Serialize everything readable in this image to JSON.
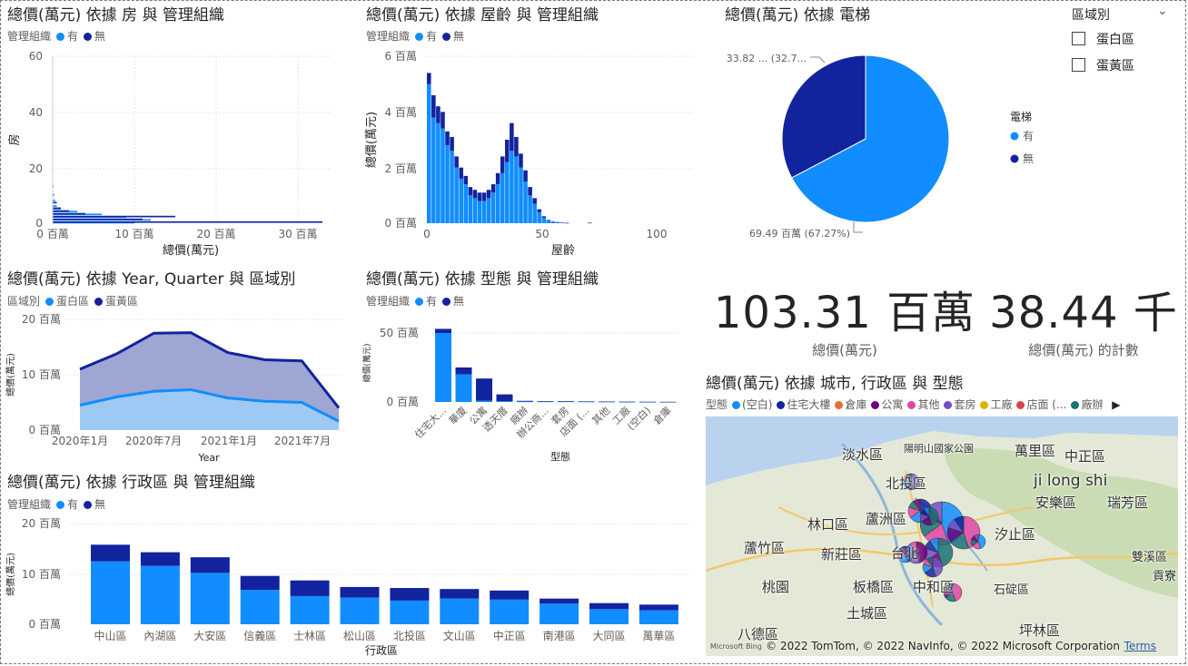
{
  "colors": {
    "light": "#118DFF",
    "dark": "#12239E",
    "purple": "#744EC2"
  },
  "charts": {
    "rooms": {
      "title": "總價(萬元) 依據 房 與 管理組織",
      "legend_title": "管理組織",
      "legend": [
        {
          "name": "有",
          "color": "#118DFF"
        },
        {
          "name": "無",
          "color": "#12239E"
        }
      ],
      "xlabel": "總價(萬元)",
      "ylabel": "房",
      "xticks": [
        "0 百萬",
        "10 百萬",
        "20 百萬",
        "30 百萬"
      ],
      "yticks": [
        "60",
        "40",
        "20",
        "0"
      ]
    },
    "age": {
      "title": "總價(萬元) 依據 屋齡 與 管理組織",
      "legend_title": "管理組織",
      "legend": [
        {
          "name": "有",
          "color": "#118DFF"
        },
        {
          "name": "無",
          "color": "#12239E"
        }
      ],
      "xlabel": "屋齡",
      "ylabel": "總價(萬元)",
      "xticks": [
        "0",
        "50",
        "100"
      ],
      "yticks": [
        "6 百萬",
        "4 百萬",
        "2 百萬",
        "0 百萬"
      ]
    },
    "elevator": {
      "title": "總價(萬元) 依據 電梯",
      "legend_title": "電梯",
      "legend": [
        {
          "name": "有",
          "color": "#118DFF"
        },
        {
          "name": "無",
          "color": "#12239E"
        }
      ],
      "label_top": "33.82 ... (32.7...",
      "label_bottom": "69.49 百萬 (67.27%)"
    },
    "quarter": {
      "title": "總價(萬元) 依據 Year, Quarter 與 區域別",
      "legend_title": "區域別",
      "legend": [
        {
          "name": "蛋白區",
          "color": "#118DFF"
        },
        {
          "name": "蛋黃區",
          "color": "#12239E"
        }
      ],
      "xlabel": "Year",
      "ylabel": "總價(萬元)",
      "xticks": [
        "2020年1月",
        "2020年7月",
        "2021年1月",
        "2021年7月"
      ],
      "yticks": [
        "20 百萬",
        "10 百萬",
        "0 百萬"
      ]
    },
    "type": {
      "title": "總價(萬元) 依據 型態 與 管理組織",
      "legend_title": "管理組織",
      "legend": [
        {
          "name": "有",
          "color": "#118DFF"
        },
        {
          "name": "無",
          "color": "#12239E"
        }
      ],
      "xlabel": "型態",
      "ylabel": "總價(萬元)",
      "yticks": [
        "50 百萬",
        "0 百萬"
      ]
    },
    "district": {
      "title": "總價(萬元) 依據 行政區 與 管理組織",
      "legend_title": "管理組織",
      "legend": [
        {
          "name": "有",
          "color": "#118DFF"
        },
        {
          "name": "無",
          "color": "#12239E"
        }
      ],
      "xlabel": "行政區",
      "ylabel": "總價(萬元)",
      "yticks": [
        "20 百萬",
        "10 百萬",
        "0 百萬"
      ]
    },
    "map": {
      "title": "總價(萬元) 依據 城市, 行政區 與 型態",
      "legend_title": "型態",
      "legend": [
        {
          "name": "(空白)",
          "color": "#118DFF"
        },
        {
          "name": "住宅大樓",
          "color": "#12239E"
        },
        {
          "name": "倉庫",
          "color": "#E66C37"
        },
        {
          "name": "公寓",
          "color": "#6B007B"
        },
        {
          "name": "其他",
          "color": "#E044A7"
        },
        {
          "name": "套房",
          "color": "#744EC2"
        },
        {
          "name": "工廠",
          "color": "#D9B300"
        },
        {
          "name": "店面 (...",
          "color": "#D64550"
        },
        {
          "name": "廠辦",
          "color": "#197278"
        }
      ],
      "places": [
        "淡水區",
        "陽明山國家公園",
        "萬里區",
        "中正區",
        "北投區",
        "ji long shi",
        "安樂區",
        "瑞芳區",
        "林口區",
        "蘆洲區",
        "汐止區",
        "蘆竹區",
        "新莊區",
        "台北",
        "雙溪區",
        "桃園",
        "板橋區",
        "中和區",
        "石碇區",
        "土城區",
        "八德區",
        "坪林區",
        "貢寮"
      ],
      "copyright": "© 2022 TomTom, © 2022 NavInfo, © 2022 Microsoft Corporation",
      "terms": "Terms",
      "bing": "Microsoft Bing"
    }
  },
  "slicer": {
    "title": "區域別",
    "items": [
      "蛋白區",
      "蛋黃區"
    ]
  },
  "cards": [
    {
      "value": "103.31 百萬",
      "label": "總價(萬元)"
    },
    {
      "value": "38.44 千",
      "label": "總價(萬元) 的計數"
    }
  ],
  "chart_data": [
    {
      "type": "bar",
      "title": "總價(萬元) 依據 房 與 管理組織",
      "xlabel": "總價(萬元)",
      "ylabel": "房",
      "xlim": [
        0,
        35
      ],
      "ylim": [
        0,
        60
      ],
      "orientation": "horizontal",
      "series": [
        {
          "name": "有",
          "points": [
            [
              10,
              0
            ],
            [
              12,
              1
            ],
            [
              9,
              2
            ],
            [
              6,
              3
            ],
            [
              3,
              4
            ],
            [
              1,
              5
            ],
            [
              0.5,
              6
            ],
            [
              0.3,
              8
            ],
            [
              0.2,
              10
            ],
            [
              0.1,
              13
            ]
          ]
        },
        {
          "name": "無",
          "points": [
            [
              33,
              0
            ],
            [
              11,
              1
            ],
            [
              15,
              2
            ],
            [
              4,
              3
            ],
            [
              2,
              4
            ],
            [
              1,
              5
            ],
            [
              0.5,
              7
            ]
          ]
        }
      ]
    },
    {
      "type": "bar",
      "title": "總價(萬元) 依據 屋齡 與 管理組織",
      "xlabel": "屋齡",
      "ylabel": "總價(萬元)",
      "xlim": [
        0,
        120
      ],
      "ylim": [
        0,
        6
      ],
      "x": [
        0,
        2,
        4,
        6,
        8,
        10,
        12,
        14,
        16,
        18,
        20,
        22,
        24,
        26,
        28,
        30,
        32,
        34,
        36,
        38,
        40,
        42,
        44,
        46,
        48,
        50,
        52,
        54,
        56,
        58,
        60,
        70
      ],
      "series": [
        {
          "name": "有",
          "values": [
            5.0,
            3.8,
            3.6,
            3.4,
            2.8,
            2.6,
            2.0,
            1.6,
            1.4,
            1.0,
            0.9,
            0.8,
            0.8,
            0.9,
            1.1,
            1.4,
            1.8,
            2.2,
            2.6,
            2.4,
            2.0,
            1.5,
            1.0,
            0.7,
            0.4,
            0.2,
            0.1,
            0.05,
            0.03,
            0.02,
            0.01,
            0.01
          ]
        },
        {
          "name": "無",
          "values": [
            0.4,
            0.8,
            0.6,
            0.6,
            0.5,
            0.5,
            0.4,
            0.4,
            0.3,
            0.3,
            0.3,
            0.3,
            0.3,
            0.3,
            0.3,
            0.4,
            0.6,
            0.8,
            1.0,
            0.7,
            0.5,
            0.4,
            0.3,
            0.2,
            0.1,
            0.05,
            0.02,
            0.01,
            0.01,
            0.0,
            0.0,
            0.01
          ]
        }
      ]
    },
    {
      "type": "pie",
      "title": "總價(萬元) 依據 電梯",
      "labels": [
        "有",
        "無"
      ],
      "values": [
        69.49,
        33.82
      ],
      "percent": [
        67.27,
        32.73
      ]
    },
    {
      "type": "area",
      "title": "總價(萬元) 依據 Year, Quarter 與 區域別",
      "xlabel": "Year",
      "ylabel": "總價(萬元)",
      "ylim": [
        0,
        20
      ],
      "categories": [
        "2020 Q1",
        "2020 Q2",
        "2020 Q3",
        "2020 Q4",
        "2021 Q1",
        "2021 Q2",
        "2021 Q3",
        "2021 Q4"
      ],
      "series": [
        {
          "name": "蛋白區",
          "values": [
            4.5,
            6.0,
            7.0,
            7.3,
            5.8,
            5.2,
            5.0,
            1.6
          ]
        },
        {
          "name": "蛋黃區",
          "values": [
            11.0,
            13.8,
            17.5,
            17.6,
            14.0,
            12.7,
            12.5,
            4.0
          ]
        }
      ]
    },
    {
      "type": "bar",
      "title": "總價(萬元) 依據 型態 與 管理組織",
      "xlabel": "型態",
      "ylabel": "總價(萬元)",
      "ylim": [
        0,
        60
      ],
      "categories": [
        "住宅大...",
        "華廈",
        "公寓",
        "透天厝",
        "廠辦",
        "辦公商...",
        "套房",
        "店面 (...",
        "其他",
        "工廠",
        "(空白)",
        "倉庫"
      ],
      "series": [
        {
          "name": "有",
          "values": [
            50,
            20,
            1,
            0.5,
            0.3,
            0.3,
            0.3,
            0.2,
            0.2,
            0.1,
            0.1,
            0.05
          ]
        },
        {
          "name": "無",
          "values": [
            3,
            5,
            16,
            5,
            0.5,
            0.3,
            0.3,
            0.2,
            0.1,
            0.1,
            0.05,
            0.05
          ]
        }
      ]
    },
    {
      "type": "bar",
      "title": "總價(萬元) 依據 行政區 與 管理組織",
      "xlabel": "行政區",
      "ylabel": "總價(萬元)",
      "ylim": [
        0,
        20
      ],
      "categories": [
        "中山區",
        "內湖區",
        "大安區",
        "信義區",
        "士林區",
        "松山區",
        "北投區",
        "文山區",
        "中正區",
        "南港區",
        "大同區",
        "萬華區"
      ],
      "series": [
        {
          "name": "有",
          "values": [
            12.5,
            11.6,
            10.2,
            6.8,
            5.6,
            5.3,
            4.7,
            5.1,
            4.9,
            4.1,
            3.0,
            2.8
          ]
        },
        {
          "name": "無",
          "values": [
            3.3,
            2.7,
            3.1,
            2.8,
            3.1,
            2.1,
            2.5,
            1.9,
            1.8,
            1.0,
            1.2,
            1.1
          ]
        }
      ]
    }
  ]
}
